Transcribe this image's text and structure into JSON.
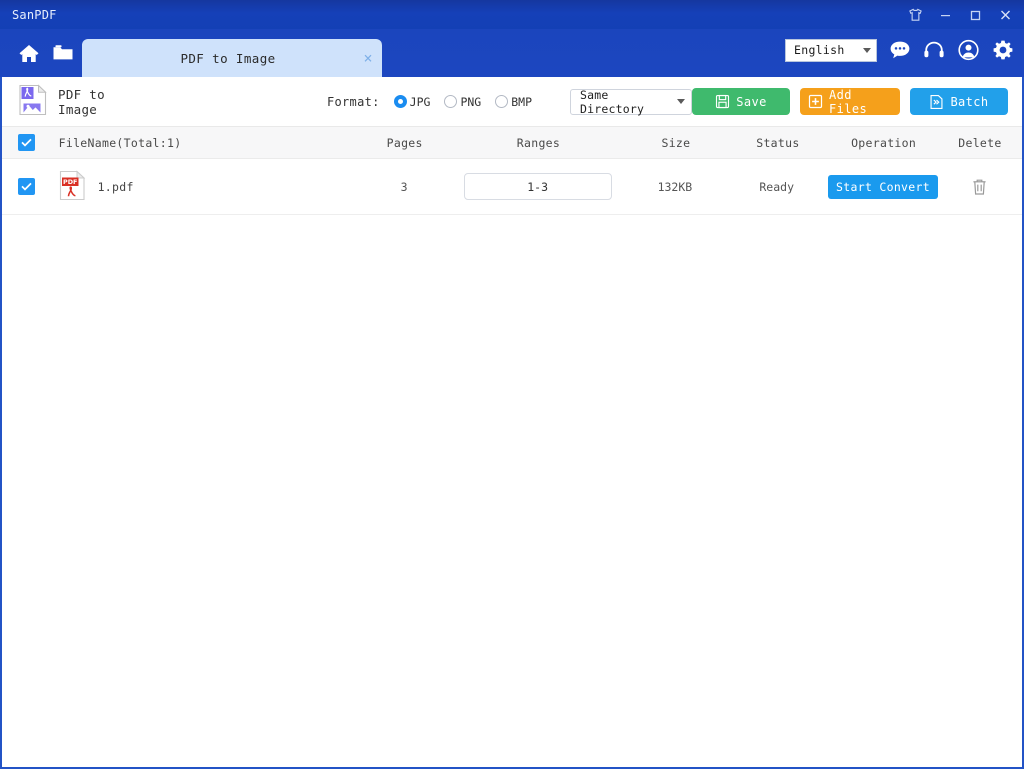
{
  "window": {
    "app_title": "SanPDF",
    "controls": [
      {
        "name": "skin-icon",
        "label": "Skin"
      },
      {
        "name": "minimize-icon",
        "label": "Minimize"
      },
      {
        "name": "maximize-icon",
        "label": "Maximize"
      },
      {
        "name": "close-icon",
        "label": "Close"
      }
    ],
    "border_color": "#2353c6",
    "titlebar_color": "#1540b8"
  },
  "navbar": {
    "home_icon": "home-icon",
    "folder_icon": "folder-icon",
    "tab": {
      "label": "PDF to Image",
      "close_label": "×",
      "background": "#cfe2fb"
    },
    "language": {
      "value": "English",
      "options": [
        "English"
      ]
    },
    "right_icons": [
      {
        "name": "chat-icon",
        "label": "Feedback"
      },
      {
        "name": "headset-icon",
        "label": "Support"
      },
      {
        "name": "account-icon",
        "label": "Account"
      },
      {
        "name": "gear-icon",
        "label": "Settings"
      }
    ]
  },
  "toolbar": {
    "tool_icon": "pdf-to-image-icon",
    "tool_label": "PDF to Image",
    "format_label": "Format:",
    "formats": [
      {
        "label": "JPG",
        "selected": true
      },
      {
        "label": "PNG",
        "selected": false
      },
      {
        "label": "BMP",
        "selected": false
      }
    ],
    "output_dir": {
      "value": "Same Directory",
      "options": [
        "Same Directory"
      ]
    },
    "save_label": "Save",
    "add_files_label": "Add Files",
    "batch_label": "Batch",
    "save_color": "#3fba6d",
    "add_color": "#f5a01b",
    "batch_color": "#22a0ea"
  },
  "table": {
    "header": {
      "select_all_checked": true,
      "filename": "FileName(Total:1)",
      "pages": "Pages",
      "ranges": "Ranges",
      "size": "Size",
      "status": "Status",
      "operation": "Operation",
      "delete": "Delete"
    },
    "rows": [
      {
        "checked": true,
        "icon": "pdf-file-icon",
        "filename": "1.pdf",
        "pages": "3",
        "range_value": "1-3",
        "range_placeholder": "1-3",
        "size": "132KB",
        "status": "Ready",
        "operation_label": "Start Convert",
        "delete_icon": "trash-icon"
      }
    ]
  }
}
